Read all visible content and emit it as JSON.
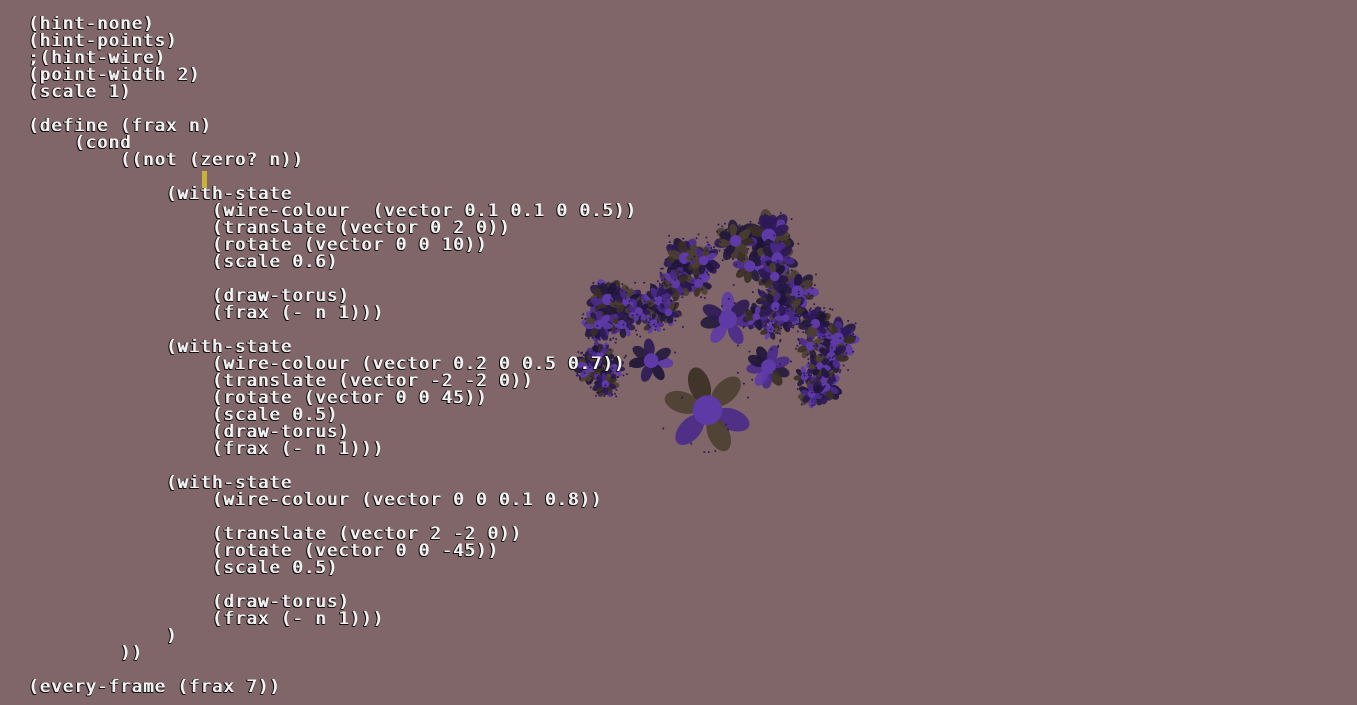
{
  "editor": {
    "lines": [
      "(hint-none)",
      "(hint-points)",
      ";(hint-wire)",
      "(point-width 2)",
      "(scale 1)",
      "",
      "(define (frax n)",
      "    (cond",
      "        ((not (zero? n))",
      "",
      "            (with-state",
      "                (wire-colour  (vector 0.1 0.1 0 0.5))",
      "                (translate (vector 0 2 0))",
      "                (rotate (vector 0 0 10))",
      "                (scale 0.6)",
      "",
      "                (draw-torus)",
      "                (frax (- n 1)))",
      "",
      "            (with-state",
      "                (wire-colour (vector 0.2 0 0.5 0.7))",
      "                (translate (vector -2 -2 0))",
      "                (rotate (vector 0 0 45))",
      "                (scale 0.5)",
      "                (draw-torus)",
      "                (frax (- n 1)))",
      "",
      "            (with-state",
      "                (wire-colour (vector 0 0 0.1 0.8))",
      "",
      "                (translate (vector 2 -2 0))",
      "                (rotate (vector 0 0 -45))",
      "                (scale 0.5)",
      "",
      "                (draw-torus)",
      "                (frax (- n 1)))",
      "            )",
      "        ))",
      "",
      "(every-frame (frax 7))"
    ],
    "cursor_line": 9,
    "cursor_column": 12
  },
  "render": {
    "background_color": "#806668",
    "text_color": "#f2f2f2",
    "cursor_color": "#c8b23a",
    "fractal_colors": [
      "#1e1438",
      "#2c1a55",
      "#4a2a8a",
      "#5e3aa6",
      "#3a3025",
      "#4b3f30",
      "#241a3c"
    ]
  }
}
